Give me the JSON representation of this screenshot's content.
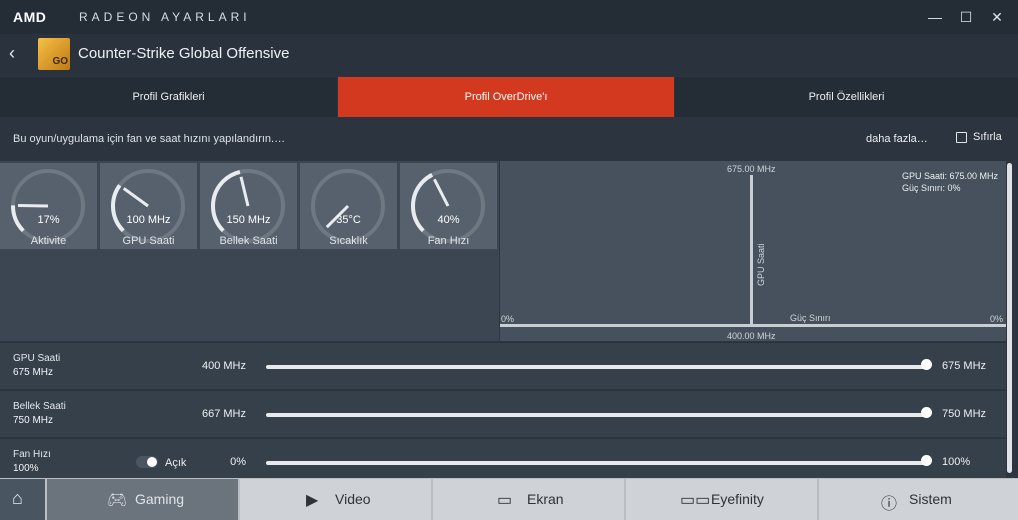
{
  "titlebar": {
    "brand": "AMD",
    "app_title": "RADEON AYARLARI",
    "minimize": "—",
    "maximize": "☐",
    "close": "✕"
  },
  "header": {
    "back": "‹",
    "game_title": "Counter-Strike Global Offensive",
    "game_icon_text": "GO"
  },
  "tabs": [
    {
      "label": "Profil Grafikleri"
    },
    {
      "label": "Profil OverDrive'ı"
    },
    {
      "label": "Profil Özellikleri"
    }
  ],
  "description": "Bu oyun/uygulama için fan ve saat hızını yapılandırın.…",
  "actions": {
    "more": "daha fazla…",
    "reset": "Sıfırla"
  },
  "gauges": [
    {
      "value": "17%",
      "label": "Aktivite",
      "level": 0.17
    },
    {
      "value": "100 MHz",
      "label": "GPU Saati",
      "level": 0.3
    },
    {
      "value": "150 MHz",
      "label": "Bellek Saati",
      "level": 0.45
    },
    {
      "value": "35°C",
      "label": "Sıcaklık",
      "level": 0.0
    },
    {
      "value": "40%",
      "label": "Fan Hızı",
      "level": 0.4
    }
  ],
  "graph": {
    "top_label": "675.00 MHz",
    "bottom_label": "400.00 MHz",
    "y_label": "GPU Saati",
    "x_label": "Güç Sınırı",
    "left_pct": "0%",
    "right_pct": "0%",
    "readout_1": "GPU Saati: 675.00 MHz",
    "readout_2": "Güç Sınırı: 0%"
  },
  "sliders": [
    {
      "name": "GPU Saati",
      "value": "675 MHz",
      "min": "400 MHz",
      "max": "675 MHz",
      "position": 1.0
    },
    {
      "name": "Bellek Saati",
      "value": "750 MHz",
      "min": "667 MHz",
      "max": "750 MHz",
      "position": 1.0
    },
    {
      "name": "Fan Hızı",
      "value": "100%",
      "min": "0%",
      "max": "100%",
      "position": 1.0,
      "toggle_label": "Açık"
    }
  ],
  "bottom_nav": [
    {
      "label": "",
      "icon": "home-icon"
    },
    {
      "label": "Gaming",
      "icon": "gamepad-icon"
    },
    {
      "label": "Video",
      "icon": "play-icon"
    },
    {
      "label": "Ekran",
      "icon": "monitor-icon"
    },
    {
      "label": "Eyefinity",
      "icon": "eyefinity-icon"
    },
    {
      "label": "Sistem",
      "icon": "info-icon"
    }
  ],
  "colors": {
    "accent": "#d3391f",
    "background": "#2c3540"
  }
}
